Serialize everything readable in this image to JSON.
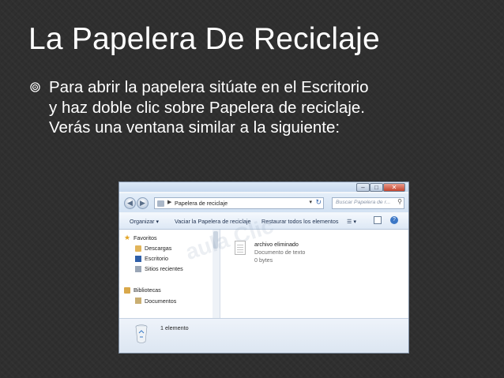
{
  "slide": {
    "title": "La Papelera De Reciclaje",
    "bullet": "Para abrir la papelera sitúate en el Escritorio y haz doble clic sobre Papelera de reciclaje. Verás una ventana similar a la siguiente:"
  },
  "window": {
    "address_crumb": "Papelera de reciclaje",
    "search_placeholder": "Buscar Papelera de r...",
    "toolbar": {
      "organize": "Organizar ▾",
      "empty": "Vaciar la Papelera de reciclaje",
      "restore": "Restaurar todos los elementos"
    },
    "nav": {
      "favorites": "Favoritos",
      "downloads": "Descargas",
      "desktop": "Escritorio",
      "recent": "Sitios recientes",
      "libraries": "Bibliotecas",
      "documents": "Documentos"
    },
    "file": {
      "name": "archivo eliminado",
      "type": "Documento de texto",
      "size": "0 bytes"
    },
    "details": "1 elemento",
    "watermark": "aula Clic"
  }
}
